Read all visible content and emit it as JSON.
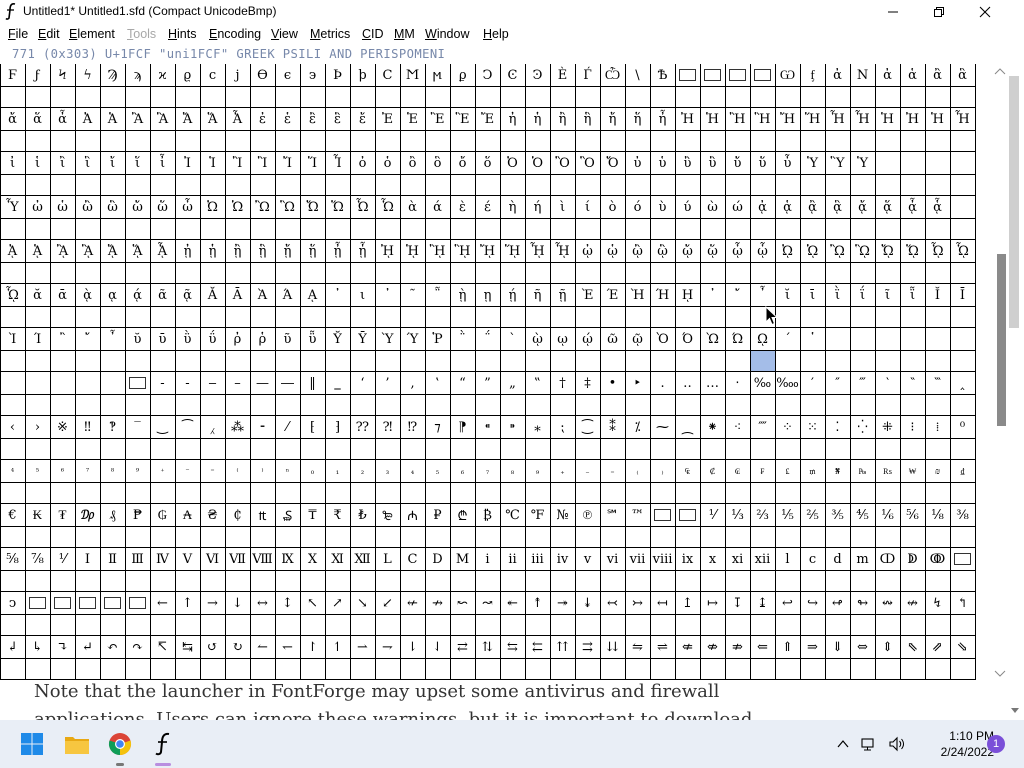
{
  "window": {
    "title": "Untitled1*  Untitled1.sfd (Compact UnicodeBmp)",
    "controls": [
      "minimize",
      "maximize",
      "close"
    ]
  },
  "menu": [
    {
      "label": "File",
      "ul": "F",
      "rest": "ile",
      "enabled": true
    },
    {
      "label": "Edit",
      "ul": "E",
      "rest": "dit",
      "enabled": true
    },
    {
      "label": "Element",
      "ul": "E",
      "rest": "lement",
      "enabled": true
    },
    {
      "label": "Tools",
      "ul": "T",
      "rest": "ools",
      "enabled": false
    },
    {
      "label": "Hints",
      "ul": "H",
      "rest": "ints",
      "enabled": true
    },
    {
      "label": "Encoding",
      "ul": "E",
      "rest": "ncoding",
      "enabled": true
    },
    {
      "label": "View",
      "ul": "V",
      "rest": "iew",
      "enabled": true
    },
    {
      "label": "Metrics",
      "ul": "M",
      "rest": "etrics",
      "enabled": true
    },
    {
      "label": "CID",
      "ul": "C",
      "rest": "ID",
      "enabled": true
    },
    {
      "label": "MM",
      "ul": "M",
      "rest": "M",
      "enabled": true
    },
    {
      "label": "Window",
      "ul": "W",
      "rest": "indow",
      "enabled": true
    },
    {
      "label": "Help",
      "ul": "H",
      "rest": "elp",
      "enabled": true
    }
  ],
  "info_line": " 771 (0x303) U+1FCF \"uni1FCF\" GREEK PSILI AND PERISPOMENI",
  "selected": {
    "row": 6,
    "col": 30
  },
  "grid_rows": [
    [
      "Ϝ",
      "ϝ",
      "Ϟ",
      "ϟ",
      "Ϡ",
      "ϡ",
      "ϰ",
      "ϱ",
      "ϲ",
      "ϳ",
      "ϴ",
      "ϵ",
      "϶",
      "Ϸ",
      "ϸ",
      "Ϲ",
      "Ϻ",
      "ϻ",
      "ϼ",
      "Ͻ",
      "Ͼ",
      "Ͽ",
      "Ѐ",
      "Ѓ",
      "Ѽ",
      "\\",
      "Ѣ",
      "▢",
      "▢",
      "▢",
      "▢",
      "Ѡ",
      "ᶂ",
      "ἀ",
      "Ν",
      "ἀ",
      "ἁ",
      "ἂ",
      "ἃ"
    ],
    [
      "ἄ",
      "ἅ",
      "ἆ",
      "Ἀ",
      "Ἁ",
      "Ἂ",
      "Ἃ",
      "Ἄ",
      "Ἅ",
      "Ἆ",
      "ἐ",
      "ἑ",
      "ἒ",
      "ἓ",
      "ἔ",
      "Ἐ",
      "Ἑ",
      "Ἒ",
      "Ἓ",
      "Ἔ",
      "ἠ",
      "ἡ",
      "ἢ",
      "ἣ",
      "ἤ",
      "ἥ",
      "ἦ",
      "Ἠ",
      "Ἡ",
      "Ἢ",
      "Ἣ",
      "Ἤ",
      "Ἥ",
      "Ἦ",
      "Ἧ",
      "Ἡ",
      "Ἠ",
      "Ἡ",
      "Ἦ"
    ],
    [
      "ἰ",
      "ἱ",
      "ἲ",
      "ἳ",
      "ἴ",
      "ἵ",
      "ἶ",
      "Ἰ",
      "Ἱ",
      "Ἲ",
      "Ἳ",
      "Ἴ",
      "Ἵ",
      "Ἶ",
      "ὀ",
      "ὁ",
      "ὂ",
      "ὃ",
      "ὄ",
      "ὅ",
      "Ὀ",
      "Ὁ",
      "Ὂ",
      "Ὃ",
      "Ὄ",
      "ὐ",
      "ὑ",
      "ὒ",
      "ὓ",
      "ὔ",
      "ὕ",
      "ὖ",
      "Ὑ",
      "Ὓ",
      "Ὑ",
      "",
      "",
      "",
      ""
    ],
    [
      "Ὗ",
      "ὠ",
      "ὡ",
      "ὢ",
      "ὣ",
      "ὤ",
      "ὥ",
      "ὦ",
      "Ὠ",
      "Ὡ",
      "Ὢ",
      "Ὣ",
      "Ὤ",
      "Ὥ",
      "Ὦ",
      "Ὧ",
      "ὰ",
      "ά",
      "ὲ",
      "έ",
      "ὴ",
      "ή",
      "ὶ",
      "ί",
      "ὸ",
      "ό",
      "ὺ",
      "ύ",
      "ὼ",
      "ώ",
      "ᾀ",
      "ᾁ",
      "ᾂ",
      "ᾃ",
      "ᾄ",
      "ᾅ",
      "ᾆ",
      "ᾇ",
      ""
    ],
    [
      "ᾈ",
      "ᾉ",
      "ᾊ",
      "ᾋ",
      "ᾌ",
      "ᾍ",
      "ᾎ",
      "ᾐ",
      "ᾑ",
      "ᾒ",
      "ᾓ",
      "ᾔ",
      "ᾕ",
      "ᾖ",
      "ᾗ",
      "ᾘ",
      "ᾙ",
      "ᾚ",
      "ᾛ",
      "ᾜ",
      "ᾝ",
      "ᾞ",
      "ᾟ",
      "ᾠ",
      "ᾡ",
      "ᾢ",
      "ᾣ",
      "ᾤ",
      "ᾥ",
      "ᾦ",
      "ᾧ",
      "ᾨ",
      "ᾩ",
      "ᾪ",
      "ᾫ",
      "ᾬ",
      "ᾭ",
      "ᾮ",
      "ᾯ"
    ],
    [
      "ᾯ",
      "ᾰ",
      "ᾱ",
      "ᾲ",
      "ᾳ",
      "ᾴ",
      "ᾶ",
      "ᾷ",
      "Ᾰ",
      "Ᾱ",
      "Ὰ",
      "Ά",
      "ᾼ",
      "᾽",
      "ι",
      "᾿",
      "῀",
      "῁",
      "ῂ",
      "ῃ",
      "ῄ",
      "ῆ",
      "ῇ",
      "Ὲ",
      "Έ",
      "Ὴ",
      "Ή",
      "ῌ",
      "᾿",
      "῎",
      "῏",
      "ῐ",
      "ῑ",
      "ῒ",
      "ΐ",
      "ῖ",
      "ῗ",
      "Ῐ",
      "Ῑ"
    ],
    [
      "Ὶ",
      "Ί",
      "῍",
      "῎",
      "῏",
      "ῠ",
      "ῡ",
      "ῢ",
      "ΰ",
      "ῤ",
      "ῥ",
      "ῦ",
      "ῧ",
      "Ῠ",
      "Ῡ",
      "Ὺ",
      "Ύ",
      "Ῥ",
      "῭",
      "΅",
      "`",
      "ῲ",
      "ῳ",
      "ῴ",
      "ῶ",
      "ῷ",
      "Ὸ",
      "Ό",
      "Ὼ",
      "Ώ",
      "ῼ",
      "´",
      "῾",
      "",
      "",
      "",
      "",
      "",
      ""
    ],
    [
      "",
      "",
      "",
      "",
      "",
      "▢",
      "‐",
      "‑",
      "‒",
      "–",
      "—",
      "―",
      "‖",
      "‗",
      "‘",
      "’",
      "‚",
      "‛",
      "“",
      "”",
      "„",
      "‟",
      "†",
      "‡",
      "•",
      "‣",
      "․",
      "‥",
      "…",
      "‧",
      "‰",
      "‱",
      "′",
      "″",
      "‴",
      "‵",
      "‶",
      "‷",
      "‸"
    ],
    [
      "‹",
      "›",
      "※",
      "‼",
      "‽",
      "‾",
      "‿",
      "⁀",
      "⁁",
      "⁂",
      "⁃",
      "⁄",
      "⁅",
      "⁆",
      "⁇",
      "⁈",
      "⁉",
      "⁊",
      "⁋",
      "⁌",
      "⁍",
      "⁎",
      "⁏",
      "⁐",
      "⁑",
      "⁒",
      "⁓",
      "⁔",
      "⁕",
      "⁖",
      "⁗",
      "⁘",
      "⁙",
      "⁚",
      "⁛",
      "⁜",
      "⁝",
      "⁞",
      "⁰"
    ],
    [
      "⁴",
      "⁵",
      "⁶",
      "⁷",
      "⁸",
      "⁹",
      "⁺",
      "⁻",
      "⁼",
      "⁽",
      "⁾",
      "ⁿ",
      "₀",
      "₁",
      "₂",
      "₃",
      "₄",
      "₅",
      "₆",
      "₇",
      "₈",
      "₉",
      "₊",
      "₋",
      "₌",
      "₍",
      "₎",
      "₠",
      "₡",
      "₢",
      "₣",
      "₤",
      "₥",
      "₦",
      "₧",
      "₨",
      "₩",
      "₪",
      "₫"
    ],
    [
      "€",
      "₭",
      "₮",
      "₯",
      "₰",
      "₱",
      "₲",
      "₳",
      "₴",
      "₵",
      "₶",
      "₷",
      "₸",
      "₹",
      "₺",
      "₻",
      "₼",
      "₽",
      "₾",
      "₿",
      "℃",
      "℉",
      "№",
      "℗",
      "℠",
      "™",
      "▢",
      "▢",
      "⅟",
      "⅓",
      "⅔",
      "⅕",
      "⅖",
      "⅗",
      "⅘",
      "⅙",
      "⅚",
      "⅛",
      "⅜"
    ],
    [
      "⅝",
      "⅞",
      "⅟",
      "Ⅰ",
      "Ⅱ",
      "Ⅲ",
      "Ⅳ",
      "Ⅴ",
      "Ⅵ",
      "Ⅶ",
      "Ⅷ",
      "Ⅸ",
      "Ⅹ",
      "Ⅺ",
      "Ⅻ",
      "Ⅼ",
      "Ⅽ",
      "Ⅾ",
      "Ⅿ",
      "ⅰ",
      "ⅱ",
      "ⅲ",
      "ⅳ",
      "ⅴ",
      "ⅵ",
      "ⅶ",
      "ⅷ",
      "ⅸ",
      "ⅹ",
      "ⅺ",
      "ⅻ",
      "ⅼ",
      "ⅽ",
      "ⅾ",
      "ⅿ",
      "ↀ",
      "ↁ",
      "ↂ",
      "▢"
    ],
    [
      "ↄ",
      "▢",
      "▢",
      "▢",
      "▢",
      "▢",
      "←",
      "↑",
      "→",
      "↓",
      "↔",
      "↕",
      "↖",
      "↗",
      "↘",
      "↙",
      "↚",
      "↛",
      "↜",
      "↝",
      "↞",
      "↟",
      "↠",
      "↡",
      "↢",
      "↣",
      "↤",
      "↥",
      "↦",
      "↧",
      "↨",
      "↩",
      "↪",
      "↫",
      "↬",
      "↭",
      "↮",
      "↯",
      "↰"
    ],
    [
      "↲",
      "↳",
      "↴",
      "↵",
      "↶",
      "↷",
      "↸",
      "↹",
      "↺",
      "↻",
      "↼",
      "↽",
      "↾",
      "↿",
      "⇀",
      "⇁",
      "⇂",
      "⇃",
      "⇄",
      "⇅",
      "⇆",
      "⇇",
      "⇈",
      "⇉",
      "⇊",
      "⇋",
      "⇌",
      "⇍",
      "⇎",
      "⇏",
      "⇐",
      "⇑",
      "⇒",
      "⇓",
      "⇔",
      "⇕",
      "⇖",
      "⇗",
      "⇘"
    ]
  ],
  "background_text": [
    "Note that the launcher in FontForge may upset some antivirus and firewall",
    "applications. Users can ignore these warnings, but it is important to download"
  ],
  "taskbar": {
    "apps": [
      "start",
      "file-explorer",
      "chrome",
      "fontforge"
    ],
    "tray_icons": [
      "chevron-up",
      "network",
      "volume"
    ],
    "time": "1:10 PM",
    "date": "2/24/2022",
    "notifications": "1"
  },
  "colors": {
    "selection": "#a4bde8",
    "info_text": "#7788aa",
    "taskbar": "#e9eef6"
  }
}
